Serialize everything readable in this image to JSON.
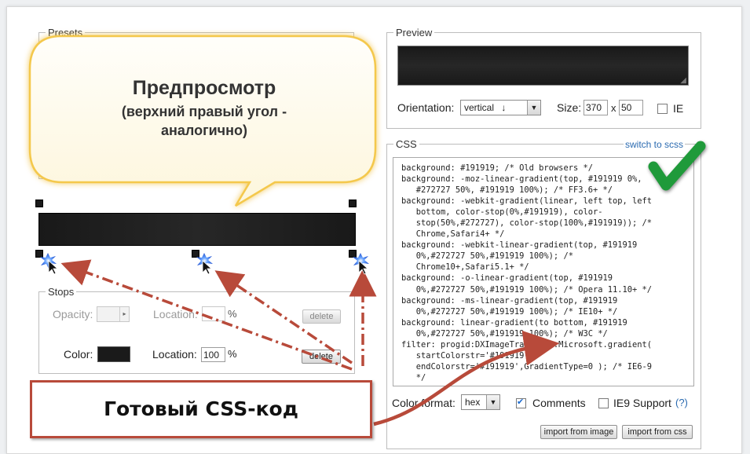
{
  "presets": {
    "legend": "Presets"
  },
  "preview": {
    "legend": "Preview",
    "orientation_label": "Orientation:",
    "orientation_value": "vertical",
    "orientation_arrow": "↓",
    "size_label": "Size:",
    "width": "370",
    "size_x": "x",
    "height": "50",
    "ie_label": "IE"
  },
  "css_panel": {
    "legend": "CSS",
    "switch_link": "switch to scss",
    "code_lines": [
      "background: #191919; /* Old browsers */",
      "background: -moz-linear-gradient(top, #191919 0%,",
      "   #272727 50%, #191919 100%); /* FF3.6+ */",
      "background: -webkit-gradient(linear, left top, left",
      "   bottom, color-stop(0%,#191919), color-",
      "   stop(50%,#272727), color-stop(100%,#191919)); /*",
      "   Chrome,Safari4+ */",
      "background: -webkit-linear-gradient(top, #191919",
      "   0%,#272727 50%,#191919 100%); /*",
      "   Chrome10+,Safari5.1+ */",
      "background: -o-linear-gradient(top, #191919",
      "   0%,#272727 50%,#191919 100%); /* Opera 11.10+ */",
      "background: -ms-linear-gradient(top, #191919",
      "   0%,#272727 50%,#191919 100%); /* IE10+ */",
      "background: linear-gradient(to bottom, #191919",
      "   0%,#272727 50%,#191919 100%); /* W3C */",
      "filter: progid:DXImageTransform.Microsoft.gradient(",
      "   startColorstr='#191919',",
      "   endColorstr='#191919',GradientType=0 ); /* IE6-9",
      "   */"
    ],
    "color_format_label": "Color format:",
    "color_format_value": "hex",
    "comments_label": "Comments",
    "ie9_label": "IE9 Support",
    "ie9_help": "(?)",
    "import_image": "import from image",
    "import_css": "import from css"
  },
  "stops": {
    "legend": "Stops",
    "opacity_label": "Opacity:",
    "location_label": "Location:",
    "percent": "%",
    "delete_label": "delete",
    "color_label": "Color:",
    "location_value": "100",
    "color_value": "#1a1a1a"
  },
  "annotations": {
    "bubble_title": "Предпросмотр",
    "bubble_line1": "(верхний правый угол -",
    "bubble_line2": "аналогично)",
    "callout_text": "Готовый CSS-код"
  },
  "colors": {
    "gradient_dark": "#191919",
    "gradient_mid": "#272727",
    "link": "#2a6ab0",
    "arrow": "#b84a3a",
    "check": "#1f9a3a"
  }
}
